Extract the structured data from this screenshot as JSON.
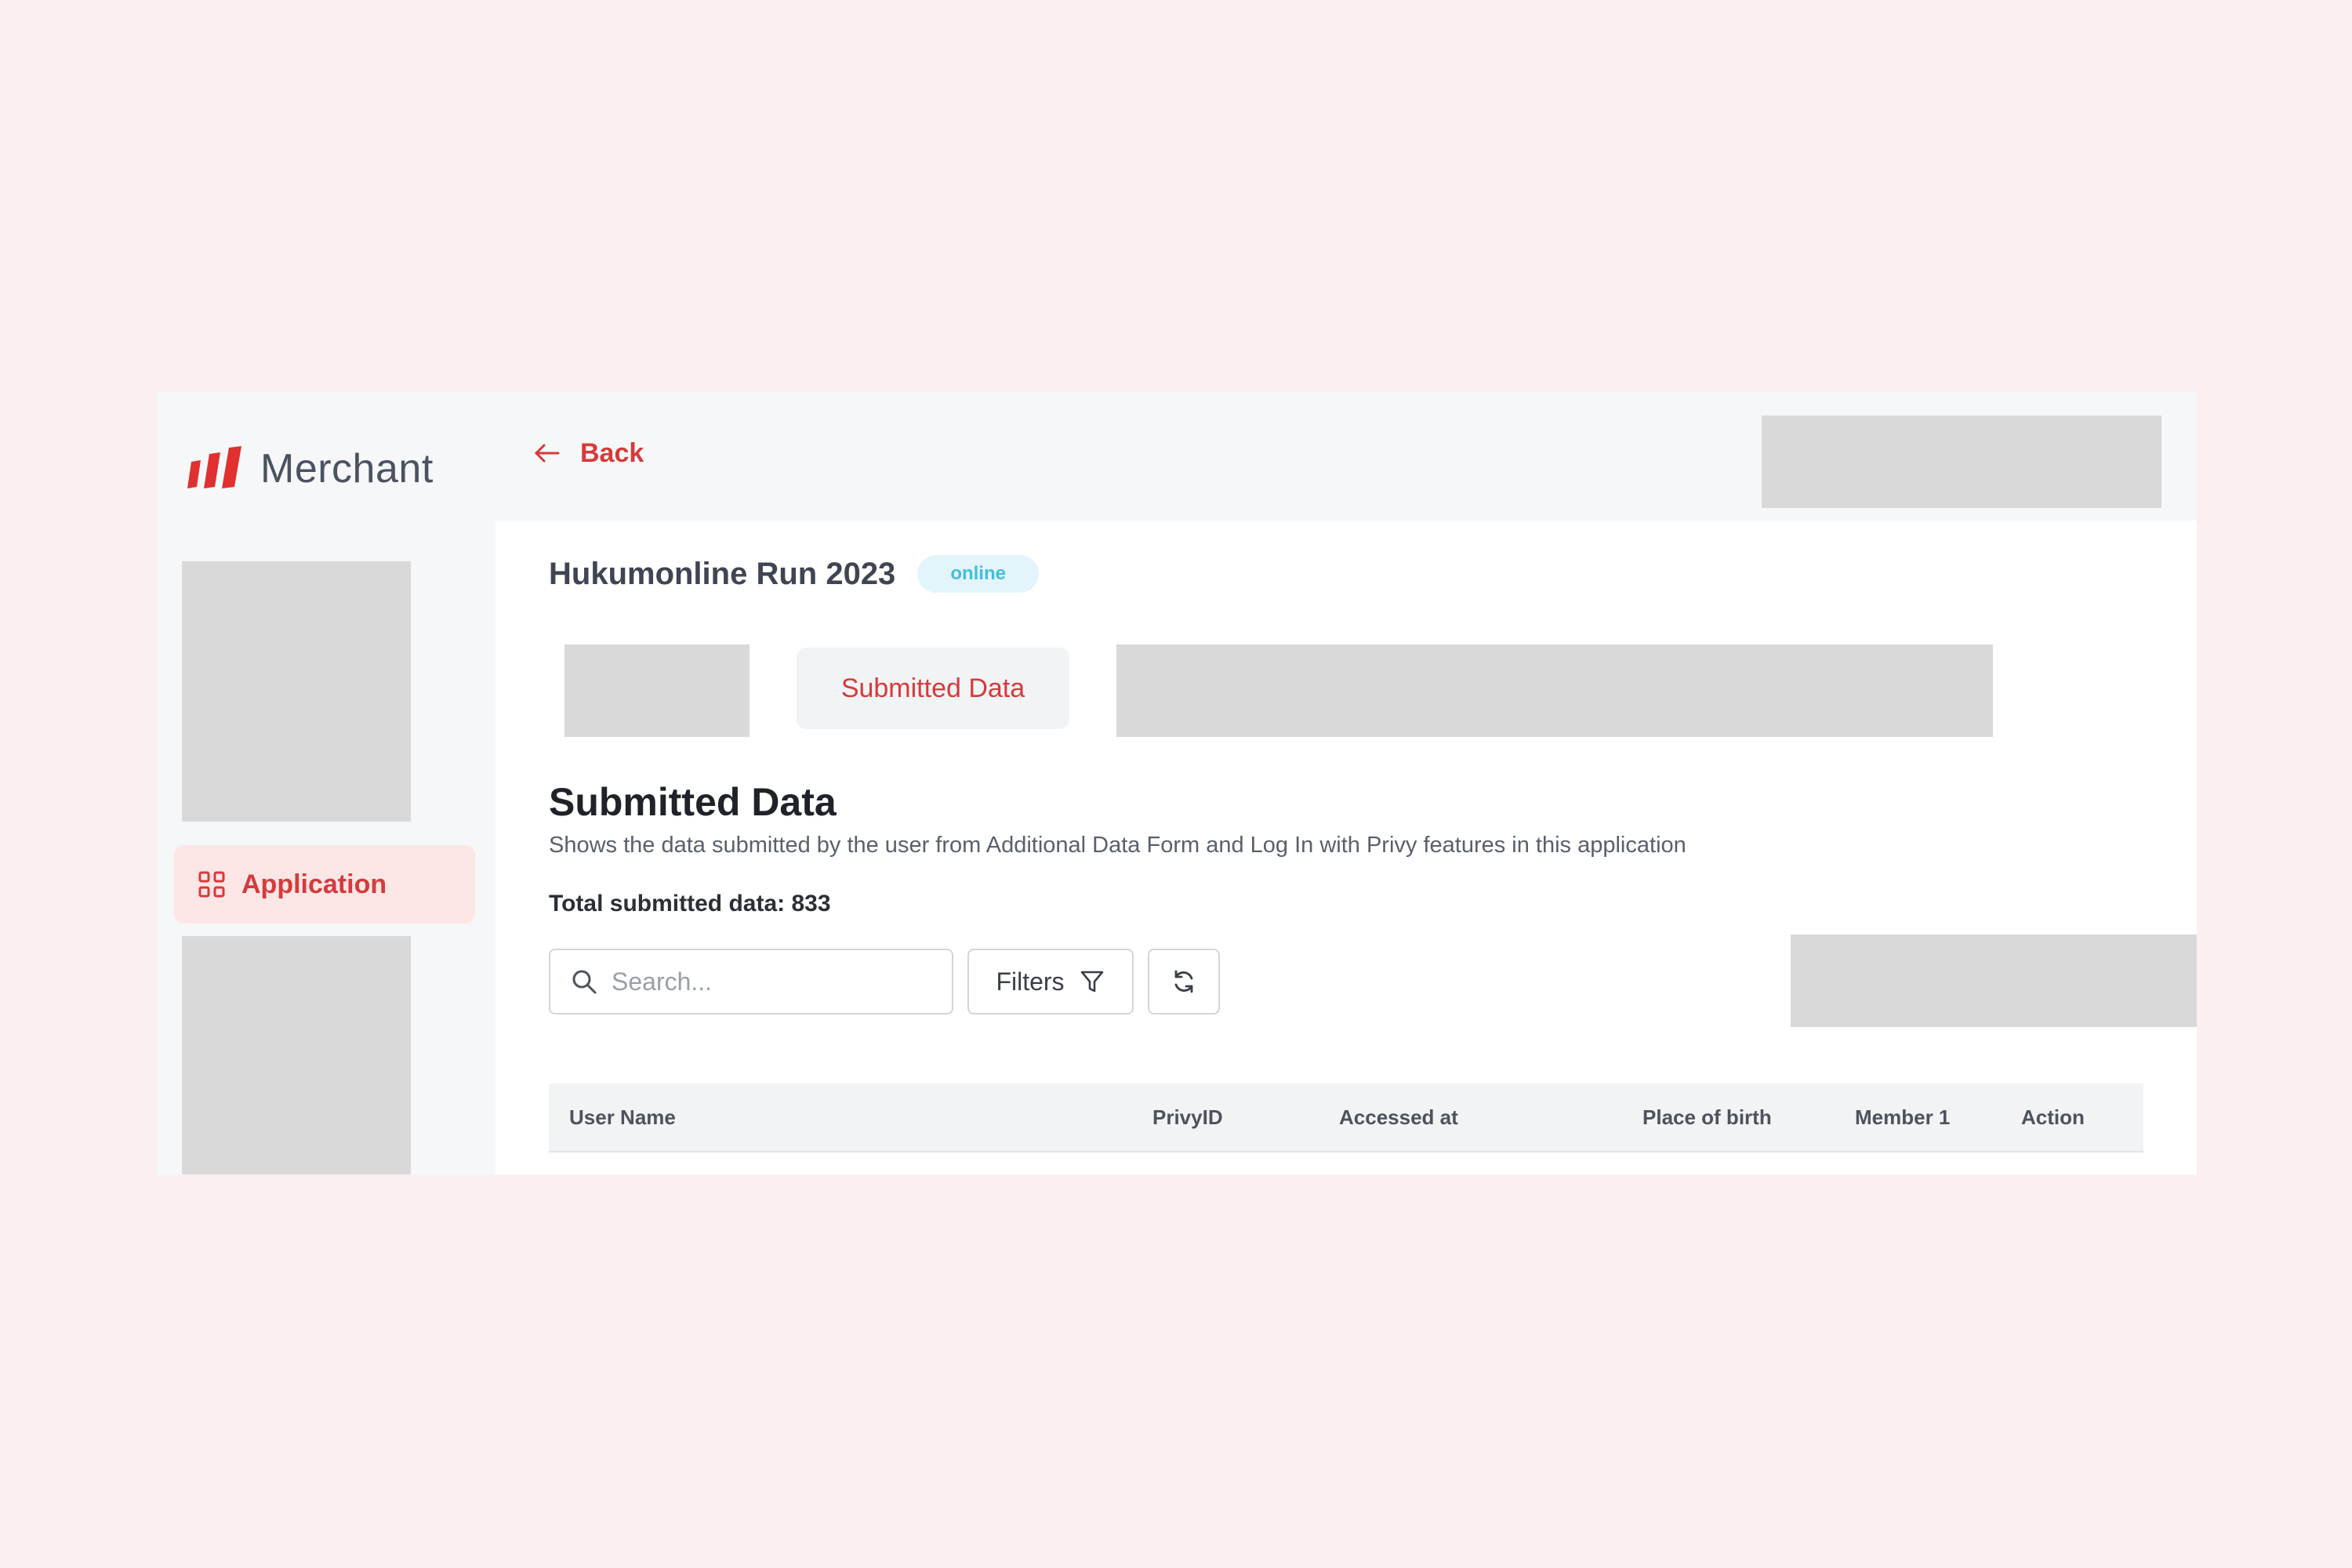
{
  "brand": {
    "name": "Merchant"
  },
  "sidebar": {
    "items": [
      {
        "label": "Application",
        "icon": "grid-icon",
        "active": true
      }
    ]
  },
  "topbar": {
    "back_label": "Back"
  },
  "event": {
    "title": "Hukumonline Run 2023",
    "status": "online"
  },
  "tabs": {
    "active_label": "Submitted Data"
  },
  "section": {
    "title": "Submitted Data",
    "description": "Shows the data submitted by the user from Additional Data Form and Log In with Privy features in this application",
    "total_label": "Total submitted data: 833"
  },
  "toolbar": {
    "search_placeholder": "Search...",
    "filters_label": "Filters"
  },
  "table": {
    "columns": [
      "User Name",
      "PrivyID",
      "Accessed at",
      "Place of birth",
      "Member 1",
      "Action"
    ]
  },
  "colors": {
    "accent": "#d63a3a",
    "accent_light": "#fde6e6",
    "badge_bg": "#e3f5fb",
    "badge_text": "#43bfdc",
    "page_bg": "#fbf0ef"
  }
}
